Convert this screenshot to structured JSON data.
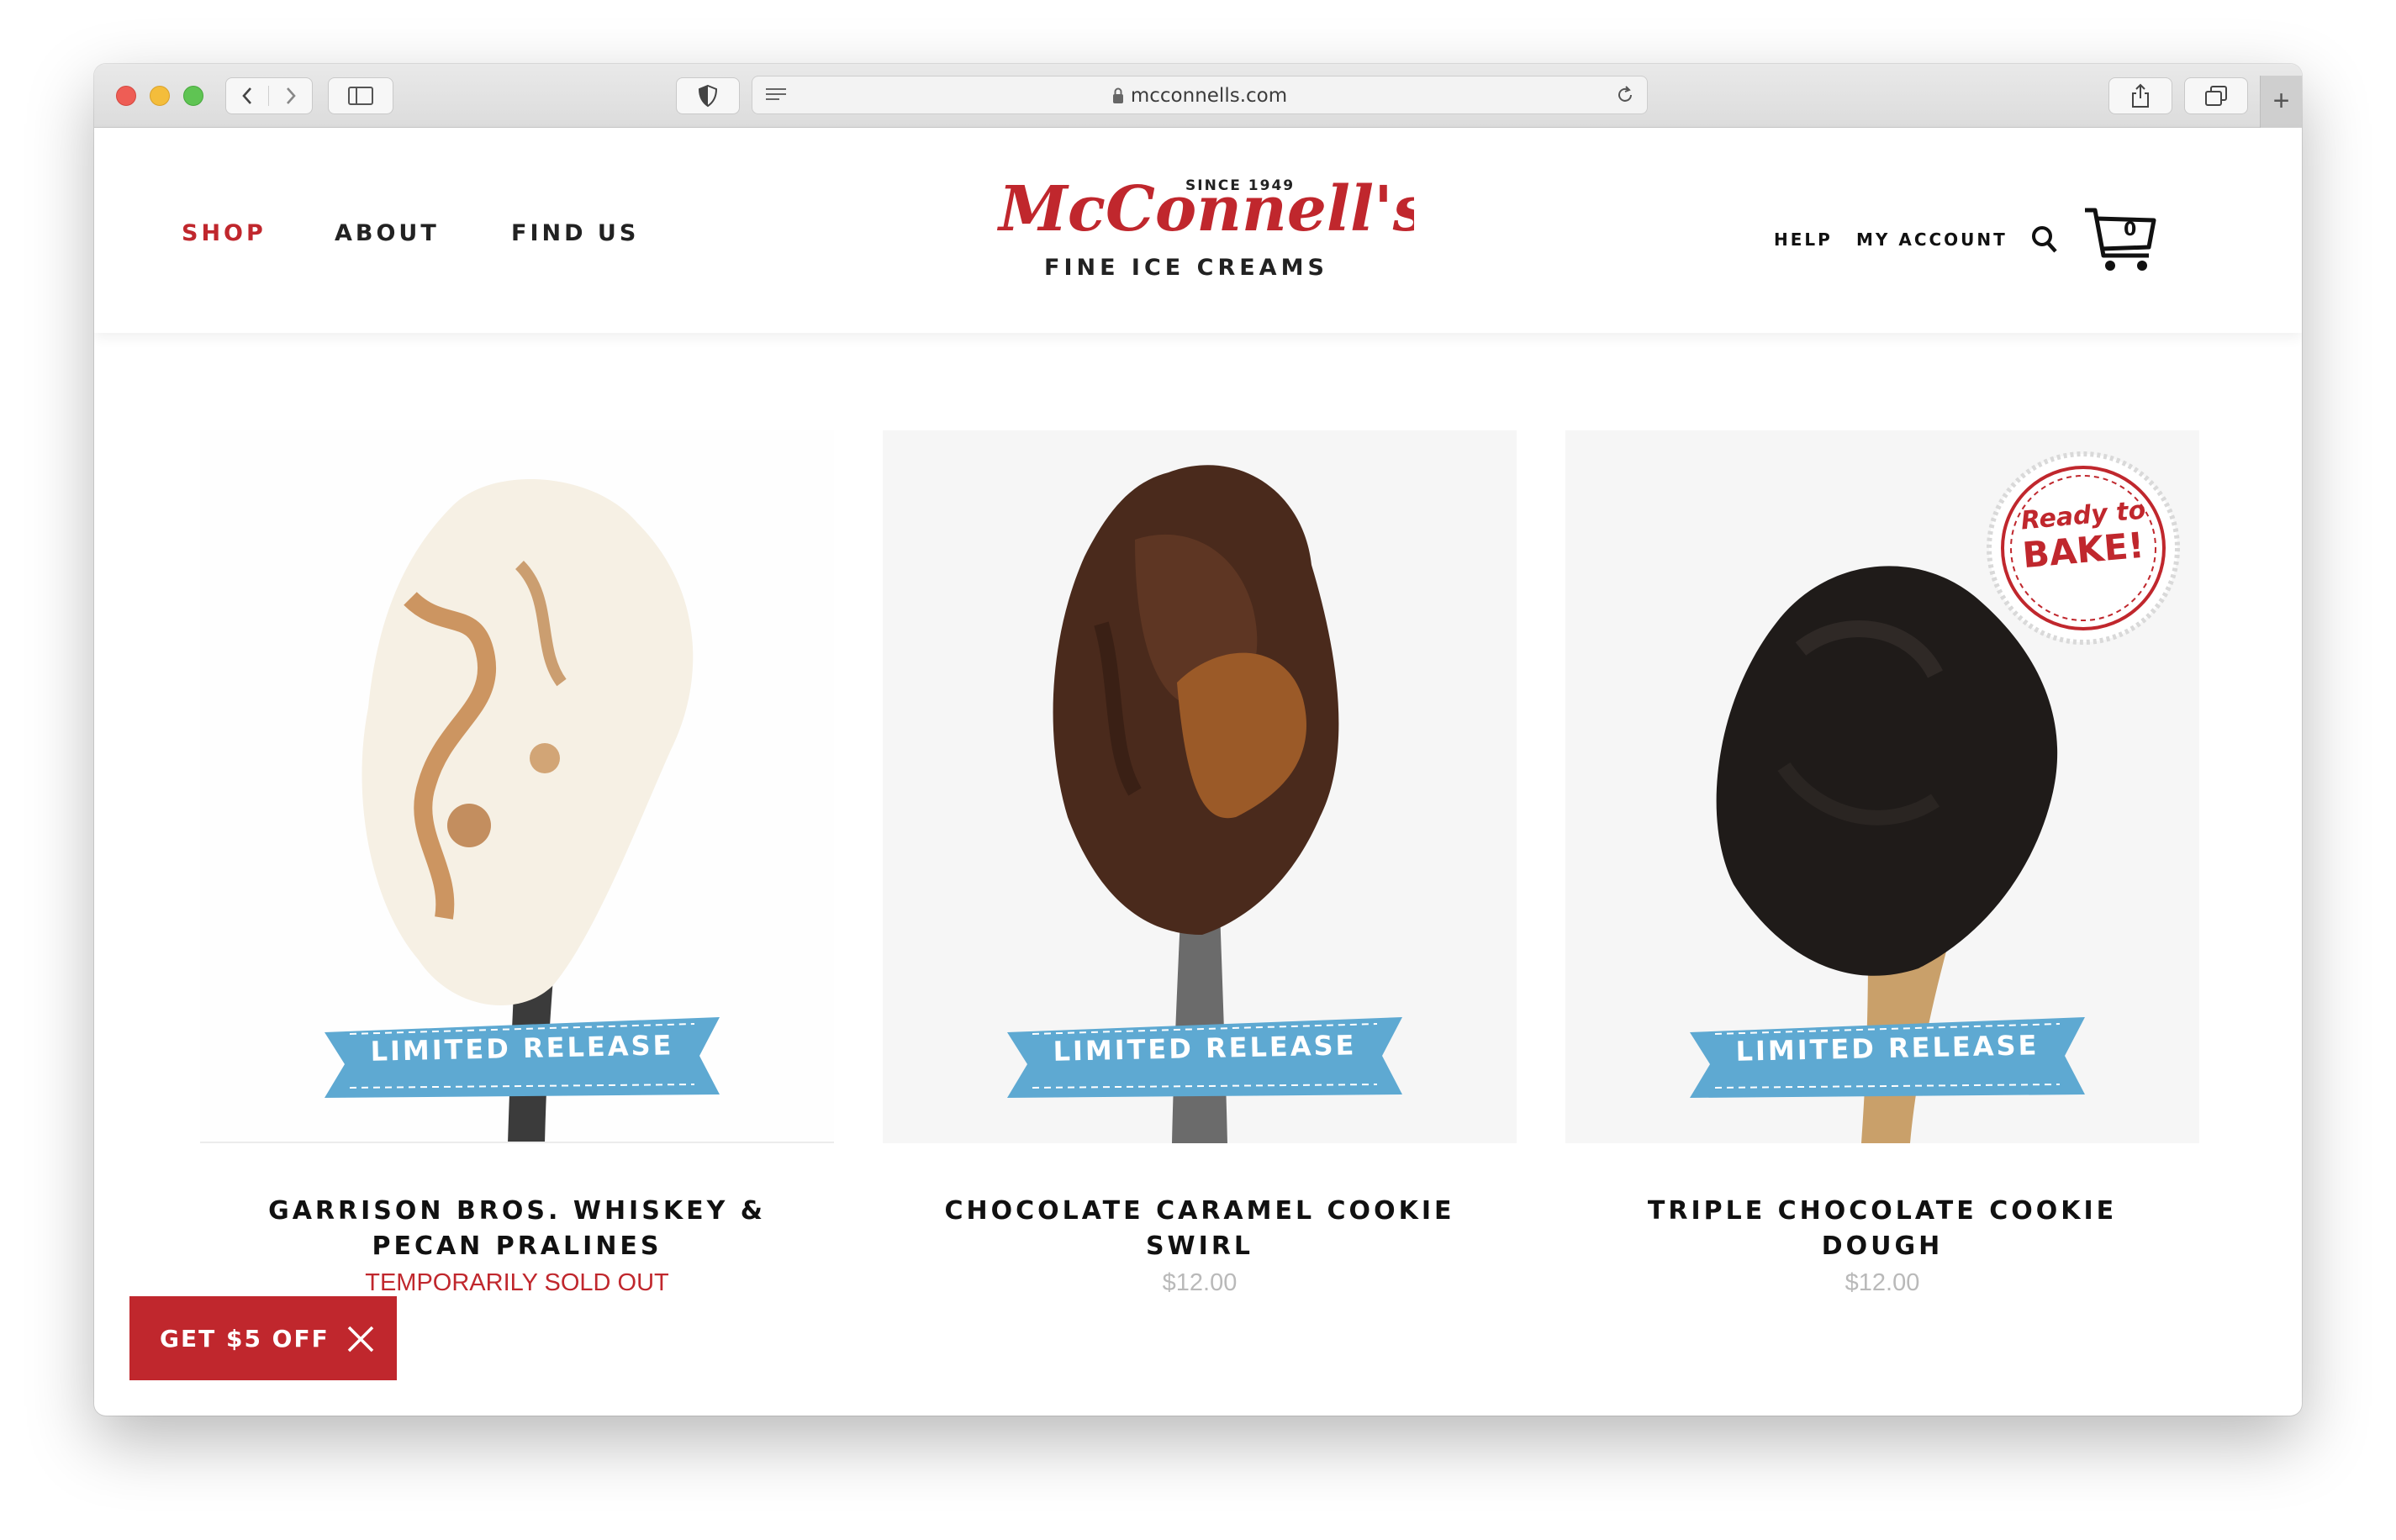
{
  "browser": {
    "url": "mcconnells.com",
    "new_tab_label": "+"
  },
  "nav": {
    "shop": "SHOP",
    "about": "ABOUT",
    "find_us": "FIND US"
  },
  "logo": {
    "script": "McConnell's",
    "since": "SINCE 1949",
    "tagline": "FINE ICE CREAMS"
  },
  "utility": {
    "help": "HELP",
    "my_account": "MY ACCOUNT",
    "cart_count": "0"
  },
  "products": [
    {
      "ribbon": "LIMITED RELEASE",
      "title": "GARRISON BROS. WHISKEY & PECAN PRALINES",
      "status": "TEMPORARILY SOLD OUT"
    },
    {
      "ribbon": "LIMITED RELEASE",
      "title": "CHOCOLATE CARAMEL COOKIE SWIRL",
      "price": "$12.00"
    },
    {
      "ribbon": "LIMITED RELEASE",
      "title": "TRIPLE CHOCOLATE COOKIE DOUGH",
      "price": "$12.00",
      "badge_top": "Ready to",
      "badge_bottom": "BAKE!"
    }
  ],
  "promo": {
    "label": "GET $5 OFF"
  },
  "colors": {
    "brand_red": "#c0272d",
    "ribbon_blue": "#5ea9d2",
    "price_gray": "#b9b9b9"
  }
}
